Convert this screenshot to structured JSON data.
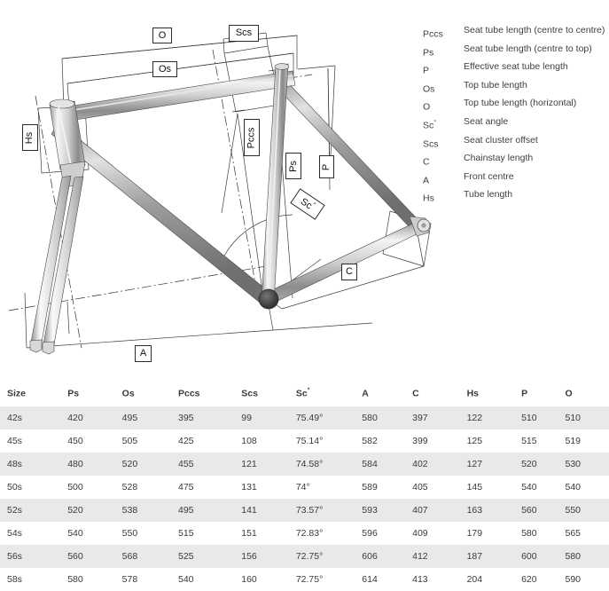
{
  "legend": {
    "items": [
      {
        "symbol": "Pccs",
        "sup": "",
        "description": "Seat tube length (centre to centre)"
      },
      {
        "symbol": "Ps",
        "sup": "",
        "description": "Seat tube length (centre to top)"
      },
      {
        "symbol": "P",
        "sup": "",
        "description": "Effective seat tube length"
      },
      {
        "symbol": "Os",
        "sup": "",
        "description": "Top tube length"
      },
      {
        "symbol": "O",
        "sup": "",
        "description": "Top tube length (horizontal)"
      },
      {
        "symbol": "Sc",
        "sup": "°",
        "description": "Seat angle"
      },
      {
        "symbol": "Scs",
        "sup": "",
        "description": "Seat cluster offset"
      },
      {
        "symbol": "C",
        "sup": "",
        "description": "Chainstay length"
      },
      {
        "symbol": "A",
        "sup": "",
        "description": "Front centre"
      },
      {
        "symbol": "Hs",
        "sup": "",
        "description": "Tube length"
      }
    ]
  },
  "diagram": {
    "callouts": [
      {
        "id": "O",
        "label": "O",
        "sup": ""
      },
      {
        "id": "Os",
        "label": "Os",
        "sup": ""
      },
      {
        "id": "Scs",
        "label": "Scs",
        "sup": ""
      },
      {
        "id": "Hs",
        "label": "Hs",
        "sup": ""
      },
      {
        "id": "Pccs",
        "label": "Pccs",
        "sup": ""
      },
      {
        "id": "Ps",
        "label": "Ps",
        "sup": ""
      },
      {
        "id": "P",
        "label": "P",
        "sup": ""
      },
      {
        "id": "Sc",
        "label": "Sc",
        "sup": "°"
      },
      {
        "id": "C",
        "label": "C",
        "sup": ""
      },
      {
        "id": "A",
        "label": "A",
        "sup": ""
      }
    ]
  },
  "table": {
    "headers": [
      {
        "label": "Size",
        "sup": ""
      },
      {
        "label": "Ps",
        "sup": ""
      },
      {
        "label": "Os",
        "sup": ""
      },
      {
        "label": "Pccs",
        "sup": ""
      },
      {
        "label": "Scs",
        "sup": ""
      },
      {
        "label": "Sc",
        "sup": "°"
      },
      {
        "label": "A",
        "sup": ""
      },
      {
        "label": "C",
        "sup": ""
      },
      {
        "label": "Hs",
        "sup": ""
      },
      {
        "label": "P",
        "sup": ""
      },
      {
        "label": "O",
        "sup": ""
      }
    ],
    "rows": [
      [
        "42s",
        "420",
        "495",
        "395",
        "99",
        "75.49°",
        "580",
        "397",
        "122",
        "510",
        "510"
      ],
      [
        "45s",
        "450",
        "505",
        "425",
        "108",
        "75.14°",
        "582",
        "399",
        "125",
        "515",
        "519"
      ],
      [
        "48s",
        "480",
        "520",
        "455",
        "121",
        "74.58°",
        "584",
        "402",
        "127",
        "520",
        "530"
      ],
      [
        "50s",
        "500",
        "528",
        "475",
        "131",
        "74°",
        "589",
        "405",
        "145",
        "540",
        "540"
      ],
      [
        "52s",
        "520",
        "538",
        "495",
        "141",
        "73.57°",
        "593",
        "407",
        "163",
        "560",
        "550"
      ],
      [
        "54s",
        "540",
        "550",
        "515",
        "151",
        "72.83°",
        "596",
        "409",
        "179",
        "580",
        "565"
      ],
      [
        "56s",
        "560",
        "568",
        "525",
        "156",
        "72.75°",
        "606",
        "412",
        "187",
        "600",
        "580"
      ],
      [
        "58s",
        "580",
        "578",
        "540",
        "160",
        "72.75°",
        "614",
        "413",
        "204",
        "620",
        "590"
      ]
    ]
  },
  "colors": {
    "text": "#3a3a3a",
    "stripe": "#e9e9e9",
    "line": "#2b2b2b",
    "tube_light": "#f2f2f2",
    "tube_mid": "#b8b8b8",
    "tube_dark": "#6e6e6e"
  }
}
